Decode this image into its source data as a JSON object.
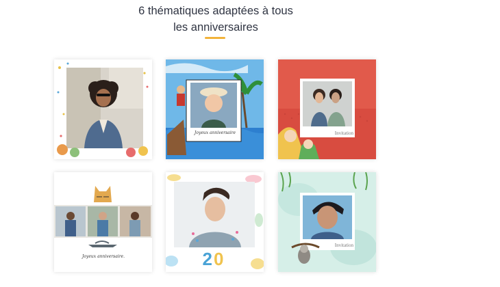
{
  "section": {
    "title_line1": "6 thématiques adaptées à tous",
    "title_line2": "les anniversaires",
    "accent_color": "#f2b33a"
  },
  "cards": [
    {
      "theme_art": "confetti-children-portrait",
      "text": ""
    },
    {
      "theme_art": "pirate-polaroid-boy",
      "text": "Joyeux anniversaire"
    },
    {
      "theme_art": "red-pop-art-polaroid",
      "text": "Invitation"
    },
    {
      "theme_art": "cat-photo-strip",
      "text": "Joyeux anniversaire."
    },
    {
      "theme_art": "watercolor-confetti-20",
      "text": "20"
    },
    {
      "theme_art": "jungle-sloth-polaroid",
      "text": "Invitation"
    }
  ]
}
